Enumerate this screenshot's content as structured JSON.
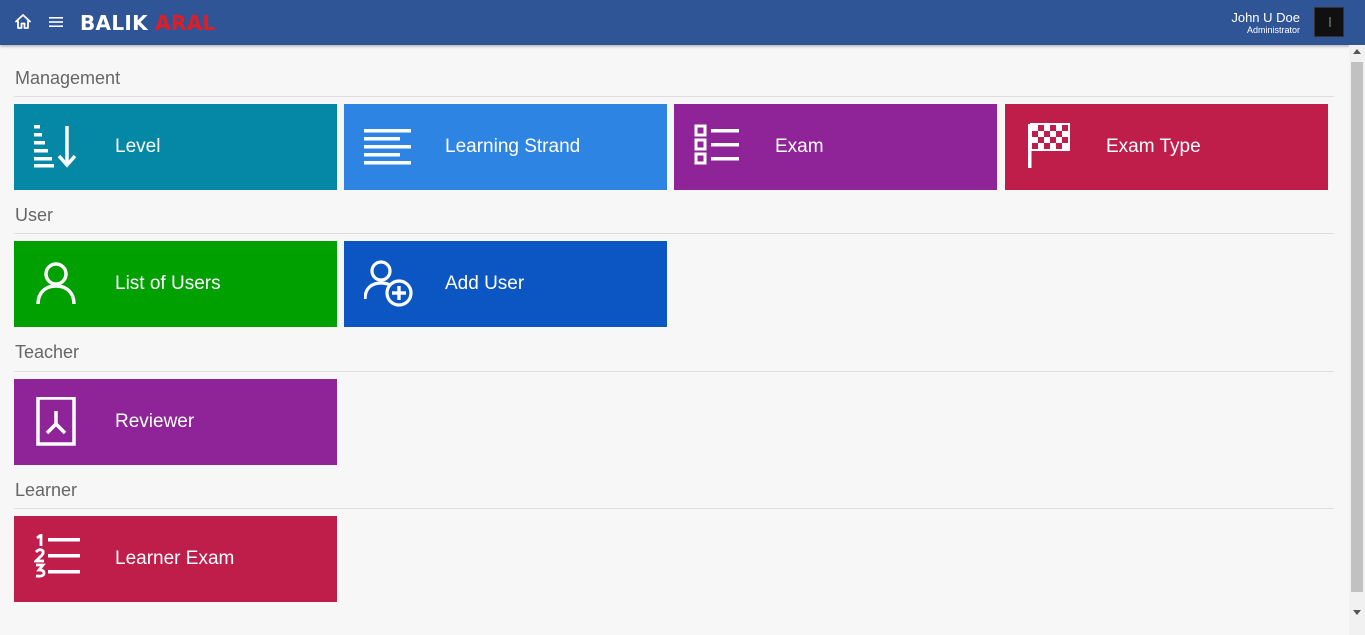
{
  "header": {
    "brand_part1": "BALIK",
    "brand_part2": "ARAL",
    "user_name": "John U Doe",
    "user_role": "Administrator",
    "colors": {
      "bar": "#2f5597",
      "brand_accent": "#e31b23"
    }
  },
  "sections": {
    "management": {
      "title": "Management",
      "tiles": {
        "level": {
          "label": "Level",
          "icon": "sort-descending-icon",
          "color": "#0588a5"
        },
        "learning_strand": {
          "label": "Learning Strand",
          "icon": "align-lines-icon",
          "color": "#2e84e2"
        },
        "exam": {
          "label": "Exam",
          "icon": "checklist-icon",
          "color": "#8e2497"
        },
        "exam_type": {
          "label": "Exam Type",
          "icon": "checkered-flag-icon",
          "color": "#bf1d4a"
        }
      }
    },
    "user": {
      "title": "User",
      "tiles": {
        "list_of_users": {
          "label": "List of Users",
          "icon": "user-icon",
          "color": "#00a000"
        },
        "add_user": {
          "label": "Add User",
          "icon": "add-user-icon",
          "color": "#0b56c3"
        }
      }
    },
    "teacher": {
      "title": "Teacher",
      "tiles": {
        "reviewer": {
          "label": "Reviewer",
          "icon": "pdf-document-icon",
          "color": "#8e2497"
        }
      }
    },
    "learner": {
      "title": "Learner",
      "tiles": {
        "learner_exam": {
          "label": "Learner Exam",
          "icon": "numbered-list-icon",
          "color": "#bf1d4a"
        }
      }
    }
  }
}
